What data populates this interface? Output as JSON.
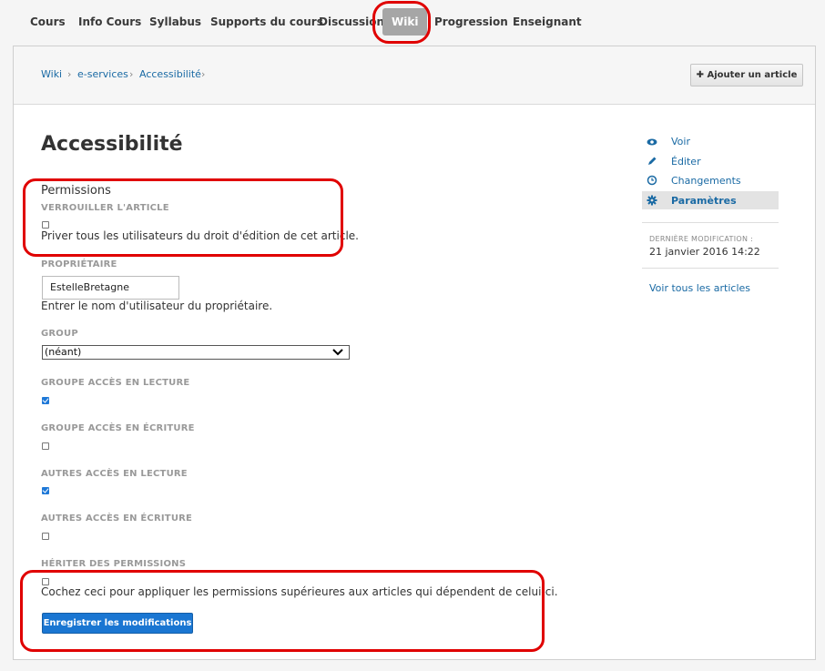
{
  "top_nav": {
    "tabs": [
      {
        "label": "Cours"
      },
      {
        "label": "Info Cours"
      },
      {
        "label": "Syllabus"
      },
      {
        "label": "Supports du cours"
      },
      {
        "label": "Discussion"
      },
      {
        "label": "Wiki",
        "active": true
      },
      {
        "label": "Progression"
      },
      {
        "label": "Enseignant"
      }
    ]
  },
  "breadcrumb": {
    "items": [
      "Wiki",
      "e-services",
      "Accessibilité"
    ],
    "separator": "›"
  },
  "header": {
    "add_article_label": "Ajouter un article",
    "add_icon": "plus-icon"
  },
  "page": {
    "title": "Accessibilité"
  },
  "permissions": {
    "section_title": "Permissions",
    "lock": {
      "label": "VERROUILLER L'ARTICLE",
      "checked": false,
      "help": "Priver tous les utilisateurs du droit d'édition de cet article."
    },
    "owner": {
      "label": "PROPRIÉTAIRE",
      "value": "EstelleBretagne",
      "help": "Entrer le nom d'utilisateur du propriétaire."
    },
    "group": {
      "label": "GROUP",
      "selected": "(néant)"
    },
    "group_read": {
      "label": "GROUPE ACCÈS EN LECTURE",
      "checked": true
    },
    "group_write": {
      "label": "GROUPE ACCÈS EN ÉCRITURE",
      "checked": false
    },
    "others_read": {
      "label": "AUTRES ACCÈS EN LECTURE",
      "checked": true
    },
    "others_write": {
      "label": "AUTRES ACCÈS EN ÉCRITURE",
      "checked": false
    },
    "inherit": {
      "label": "HÉRITER DES PERMISSIONS",
      "checked": false,
      "help": "Cochez ceci pour appliquer les permissions supérieures aux articles qui dépendent de celui-ci."
    },
    "save_label": "Enregistrer les modifications"
  },
  "sidebar": {
    "items": [
      {
        "label": "Voir",
        "icon": "eye-icon"
      },
      {
        "label": "Éditer",
        "icon": "pencil-icon"
      },
      {
        "label": "Changements",
        "icon": "clock-icon"
      },
      {
        "label": "Paramètres",
        "icon": "gear-icon",
        "active": true
      }
    ],
    "last_modified_label": "DERNIÈRE MODIFICATION :",
    "last_modified_value": "21 janvier 2016 14:22",
    "all_articles_label": "Voir tous les articles"
  },
  "colors": {
    "accent": "#1a76d2",
    "link": "#1a6aa4",
    "annotation": "#e00000",
    "active_tab": "#a6a6a6"
  }
}
